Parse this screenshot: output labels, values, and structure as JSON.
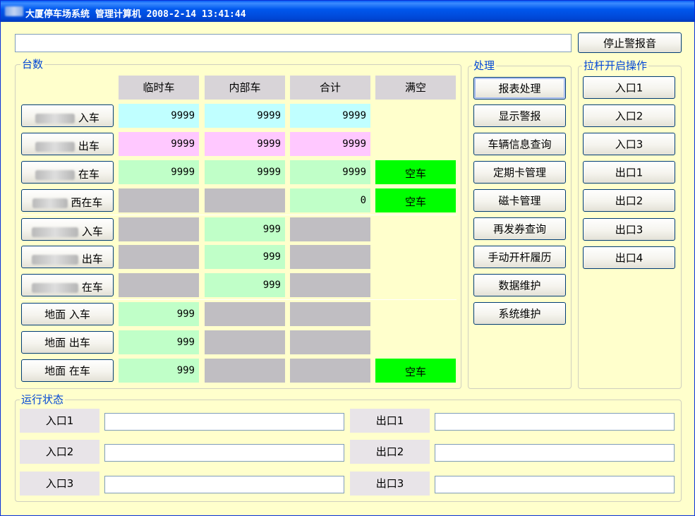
{
  "window": {
    "title": "大厦停车场系统 管理计算机 2008-2-14 13:41:44"
  },
  "top": {
    "stop_alarm_label": "停止警报音",
    "message": ""
  },
  "counts": {
    "group_title": "台数",
    "headers": [
      "临时车",
      "内部车",
      "合计",
      "满空"
    ],
    "rows": [
      {
        "label": "入车",
        "temp": "9999",
        "internal": "9999",
        "total": "9999",
        "status": ""
      },
      {
        "label": "出车",
        "temp": "9999",
        "internal": "9999",
        "total": "9999",
        "status": ""
      },
      {
        "label": "在车",
        "temp": "9999",
        "internal": "9999",
        "total": "9999",
        "status": "空车"
      },
      {
        "label": "西在车",
        "temp": "",
        "internal": "",
        "total": "0",
        "status": "空车"
      },
      {
        "label": "入车",
        "temp": "",
        "internal": "999",
        "total": "",
        "status": ""
      },
      {
        "label": "出车",
        "temp": "",
        "internal": "999",
        "total": "",
        "status": ""
      },
      {
        "label": "在车",
        "temp": "",
        "internal": "999",
        "total": "",
        "status": ""
      },
      {
        "label": "地面 入车",
        "temp": "999",
        "internal": "",
        "total": "",
        "status": ""
      },
      {
        "label": "地面 出车",
        "temp": "999",
        "internal": "",
        "total": "",
        "status": ""
      },
      {
        "label": "地面 在车",
        "temp": "999",
        "internal": "",
        "total": "",
        "status": "空车"
      }
    ]
  },
  "process": {
    "group_title": "处理",
    "buttons": [
      "报表处理",
      "显示警报",
      "车辆信息查询",
      "定期卡管理",
      "磁卡管理",
      "再发券查询",
      "手动开杆履历",
      "数据维护",
      "系统维护"
    ]
  },
  "gate": {
    "group_title": "拉杆开启操作",
    "buttons": [
      "入口1",
      "入口2",
      "入口3",
      "出口1",
      "出口2",
      "出口3",
      "出口4"
    ]
  },
  "status": {
    "group_title": "运行状态",
    "entries": [
      {
        "label": "入口1",
        "value": ""
      },
      {
        "label": "入口2",
        "value": ""
      },
      {
        "label": "入口3",
        "value": ""
      }
    ],
    "exits": [
      {
        "label": "出口1",
        "value": ""
      },
      {
        "label": "出口2",
        "value": ""
      },
      {
        "label": "出口3",
        "value": ""
      }
    ]
  },
  "colors": {
    "panel_bg": "#ffffcc",
    "titlebar": "#0058ee",
    "group_title": "#0046d5",
    "in_cell": "#c0ffff",
    "out_cell": "#ffc8ff",
    "present_cell": "#c0ffc8",
    "empty_status": "#00ff00",
    "disabled_cell": "#c0bec2"
  }
}
